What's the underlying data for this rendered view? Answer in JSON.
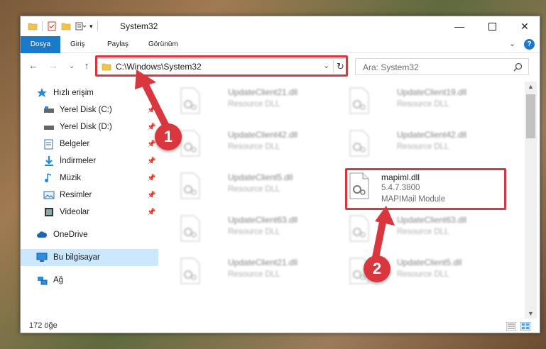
{
  "window": {
    "title": "System32"
  },
  "ribbon": {
    "tabs": [
      "Dosya",
      "Giriş",
      "Paylaş",
      "Görünüm"
    ]
  },
  "address": {
    "path": "C:\\Windows\\System32",
    "search_placeholder": "Ara: System32"
  },
  "nav": {
    "items": [
      {
        "label": "Hızlı erişim",
        "icon": "star-icon"
      },
      {
        "label": "Yerel Disk (C:)",
        "icon": "drive-icon",
        "pinned": true
      },
      {
        "label": "Yerel Disk (D:)",
        "icon": "drive-icon",
        "pinned": true
      },
      {
        "label": "Belgeler",
        "icon": "documents-icon",
        "pinned": true
      },
      {
        "label": "İndirmeler",
        "icon": "download-icon",
        "pinned": true
      },
      {
        "label": "Müzik",
        "icon": "music-icon",
        "pinned": true
      },
      {
        "label": "Resimler",
        "icon": "pictures-icon",
        "pinned": true
      },
      {
        "label": "Videolar",
        "icon": "video-icon",
        "pinned": true
      },
      {
        "label": "OneDrive",
        "icon": "cloud-icon"
      },
      {
        "label": "Bu bilgisayar",
        "icon": "computer-icon",
        "selected": true
      },
      {
        "label": "Ağ",
        "icon": "network-icon"
      }
    ]
  },
  "files": [
    {
      "name": "UpdateClient21.dll",
      "sub": "Resource DLL",
      "blurred": true
    },
    {
      "name": "UpdateClient19.dll",
      "sub": "Resource DLL",
      "blurred": true
    },
    {
      "name": "UpdateClient42.dll",
      "sub": "Resource DLL",
      "blurred": true
    },
    {
      "name": "UpdateClient42.dll",
      "sub": "Resource DLL",
      "blurred": true
    },
    {
      "name": "UpdateClient5.dll",
      "sub": "Resource DLL",
      "blurred": true
    },
    {
      "name": "mapiml.dll",
      "sub": "5.4.7.3800",
      "sub2": "MAPIMail Module",
      "blurred": false
    },
    {
      "name": "UpdateClient63.dll",
      "sub": "Resource DLL",
      "blurred": true
    },
    {
      "name": "UpdateClient63.dll",
      "sub": "Resource DLL",
      "blurred": true
    },
    {
      "name": "UpdateClient21.dll",
      "sub": "Resource DLL",
      "blurred": true
    },
    {
      "name": "UpdateClient5.dll",
      "sub": "Resource DLL",
      "blurred": true
    }
  ],
  "status": {
    "count": "172 öğe"
  },
  "annotations": {
    "badge1": "1",
    "badge2": "2",
    "color": "#d9363e"
  }
}
